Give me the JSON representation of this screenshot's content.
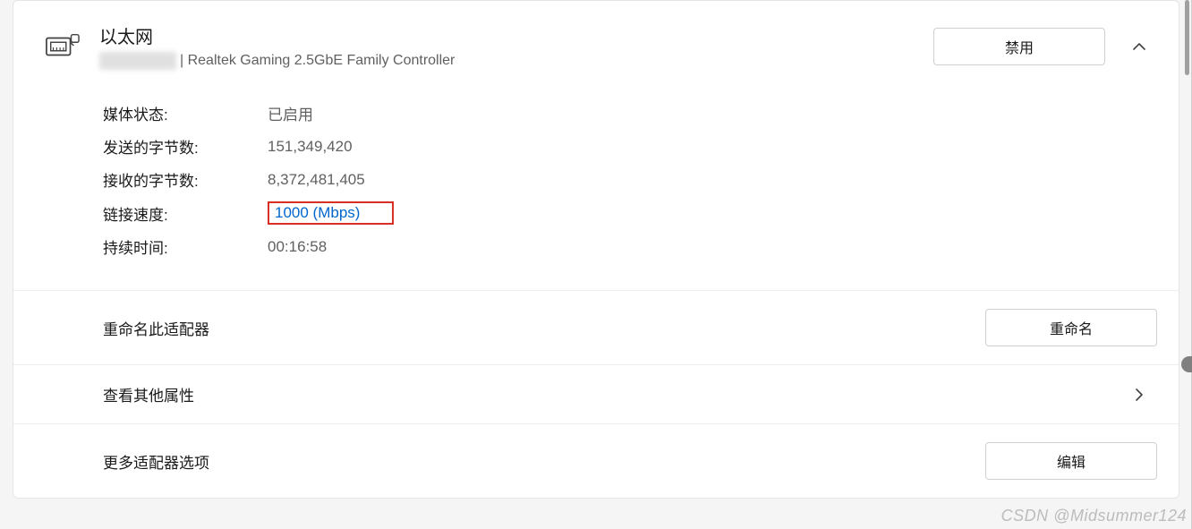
{
  "header": {
    "title": "以太网",
    "subtitle_suffix": "| Realtek Gaming 2.5GbE Family Controller",
    "disable_button": "禁用"
  },
  "details": {
    "media_state_label": "媒体状态:",
    "media_state_value": "已启用",
    "bytes_sent_label": "发送的字节数:",
    "bytes_sent_value": "151,349,420",
    "bytes_received_label": "接收的字节数:",
    "bytes_received_value": "8,372,481,405",
    "link_speed_label": "链接速度:",
    "link_speed_value": "1000 (Mbps)",
    "duration_label": "持续时间:",
    "duration_value": "00:16:58"
  },
  "sections": {
    "rename_label": "重命名此适配器",
    "rename_button": "重命名",
    "view_properties_label": "查看其他属性",
    "more_options_label": "更多适配器选项",
    "edit_button": "编辑"
  },
  "watermark": "CSDN @Midsummer124"
}
